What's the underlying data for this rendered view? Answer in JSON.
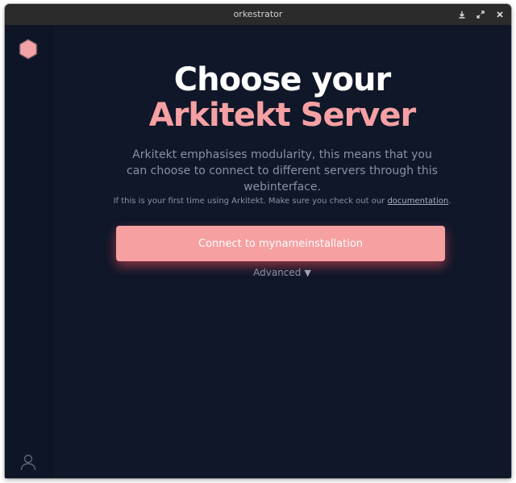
{
  "window": {
    "title": "orkestrator"
  },
  "titlebar": {
    "download_icon": "download-icon",
    "maximize_icon": "maximize-icon",
    "close_icon": "close-icon"
  },
  "sidebar": {
    "logo_icon": "hexagon-logo-icon",
    "user_icon": "user-icon"
  },
  "main": {
    "heading_line1": "Choose your",
    "heading_line2": "Arkitekt Server",
    "description": "Arkitekt emphasises modularity, this means that you can choose to connect to different servers through this webinterface.",
    "note_prefix": "If this is your first time using Arkitekt. Make sure you check out our ",
    "note_link": "documentation",
    "note_suffix": ".",
    "connect_label": "Connect to mynameinstallation",
    "advanced_label": "Advanced",
    "advanced_arrow": "▼"
  },
  "colors": {
    "background": "#0f1729",
    "accent": "#f6a0a2",
    "heading_white": "#ffffff",
    "text_muted": "#8791a6"
  }
}
